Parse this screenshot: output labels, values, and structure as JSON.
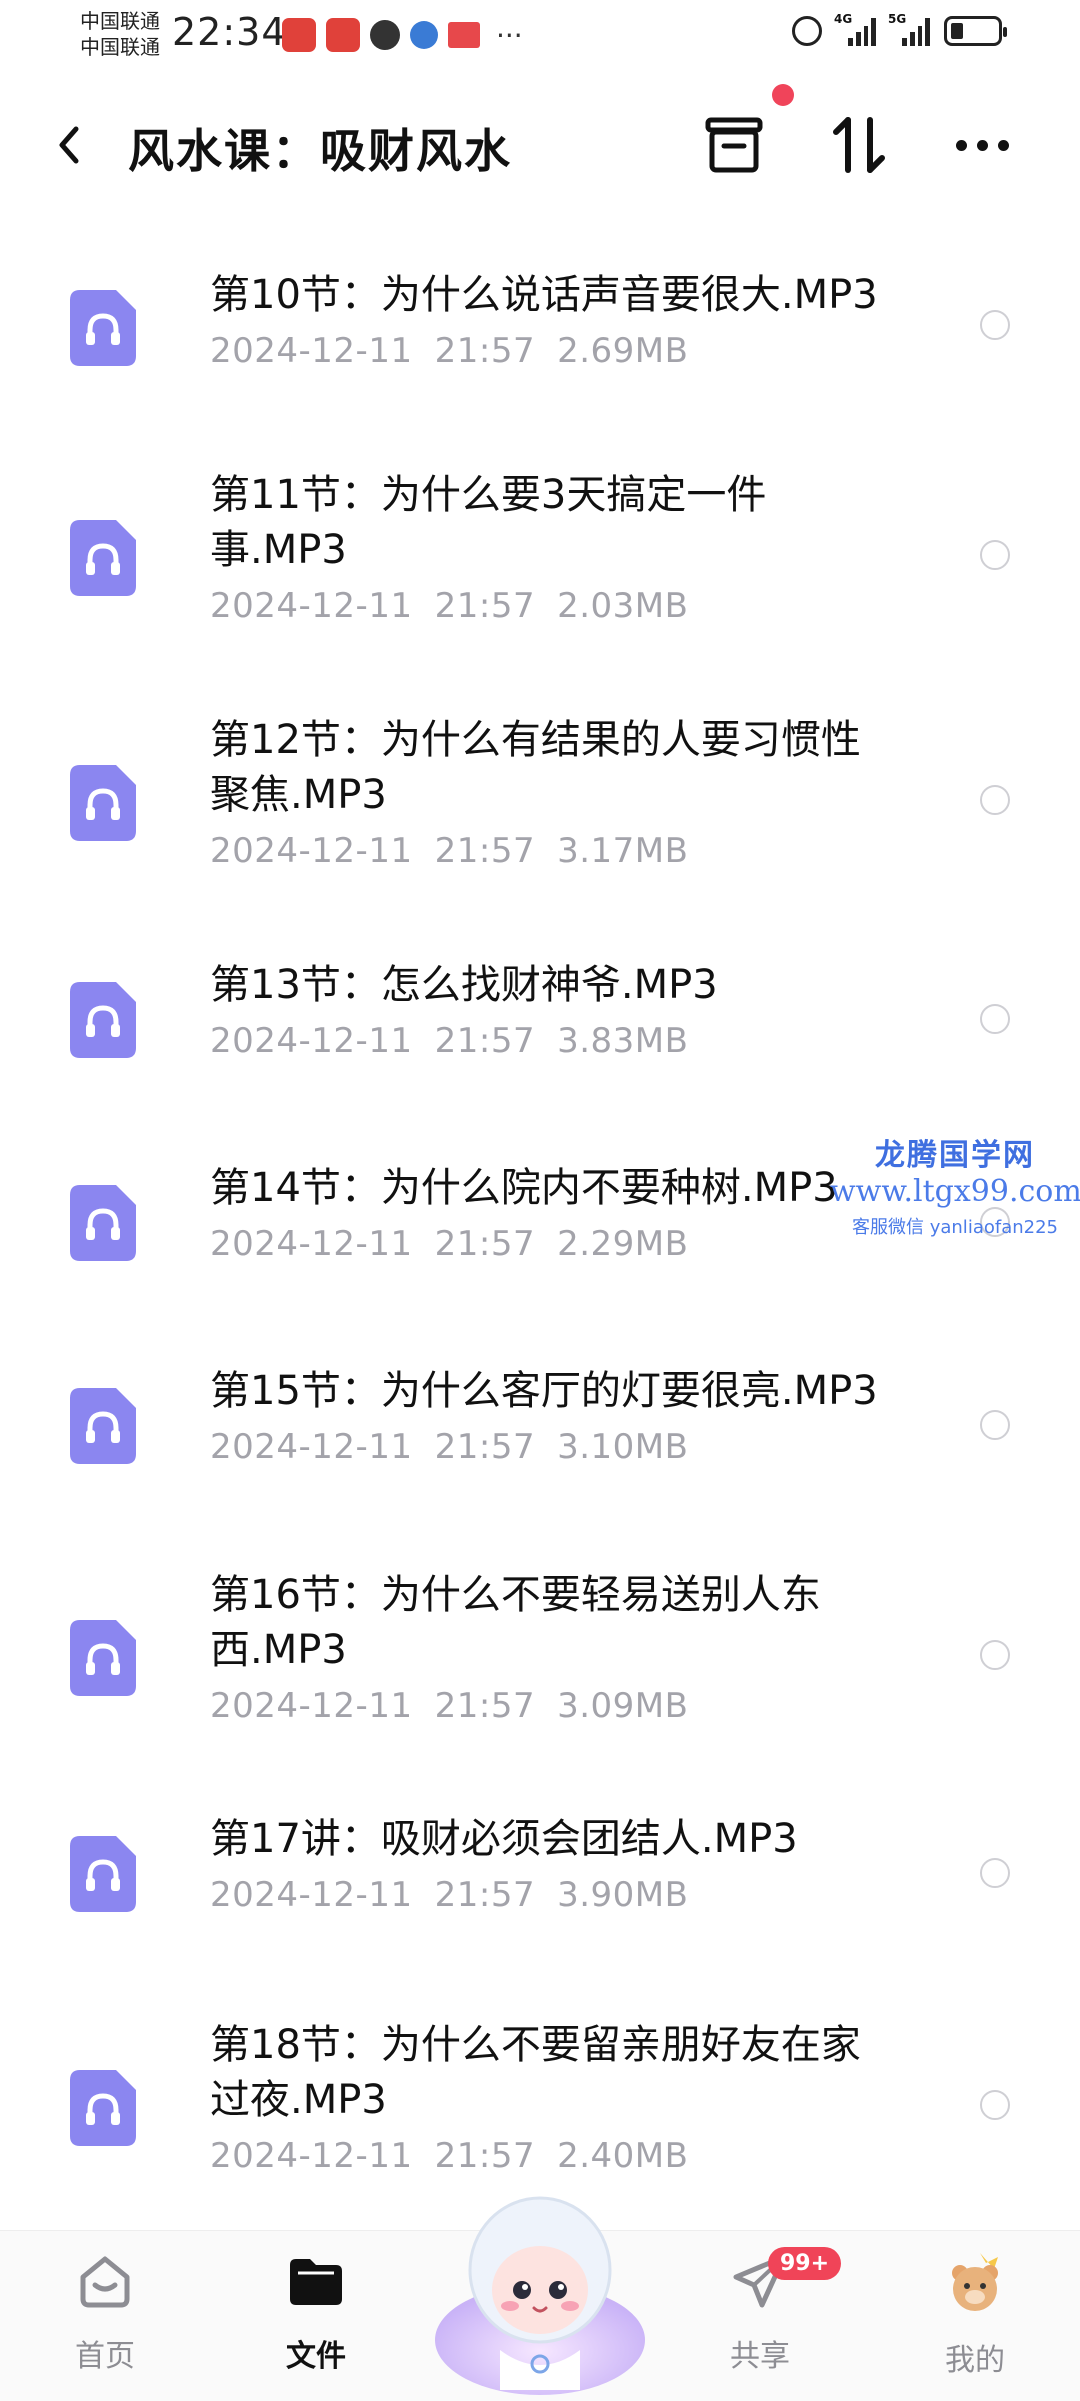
{
  "status_bar": {
    "carrier_1": "中国联通",
    "carrier_2": "中国联通",
    "time": "22:34",
    "more": "···",
    "network_1": "4G",
    "network_2": "5G"
  },
  "header": {
    "title": "风水课：吸财风水"
  },
  "files": [
    {
      "name": "第10节：为什么说话声音要很大.MP3",
      "date": "2024-12-11",
      "time": "21:57",
      "size": "2.69MB"
    },
    {
      "name": "第11节：为什么要3天搞定一件事.MP3",
      "date": "2024-12-11",
      "time": "21:57",
      "size": "2.03MB"
    },
    {
      "name": "第12节：为什么有结果的人要习惯性聚焦.MP3",
      "date": "2024-12-11",
      "time": "21:57",
      "size": "3.17MB"
    },
    {
      "name": "第13节：怎么找财神爷.MP3",
      "date": "2024-12-11",
      "time": "21:57",
      "size": "3.83MB"
    },
    {
      "name": "第14节：为什么院内不要种树.MP3",
      "date": "2024-12-11",
      "time": "21:57",
      "size": "2.29MB"
    },
    {
      "name": "第15节：为什么客厅的灯要很亮.MP3",
      "date": "2024-12-11",
      "time": "21:57",
      "size": "3.10MB"
    },
    {
      "name": "第16节：为什么不要轻易送别人东西.MP3",
      "date": "2024-12-11",
      "time": "21:57",
      "size": "3.09MB"
    },
    {
      "name": "第17讲：吸财必须会团结人.MP3",
      "date": "2024-12-11",
      "time": "21:57",
      "size": "3.90MB"
    },
    {
      "name": "第18节：为什么不要留亲朋好友在家过夜.MP3",
      "date": "2024-12-11",
      "time": "21:57",
      "size": "2.40MB"
    }
  ],
  "watermark": {
    "line1": "龙腾国学网",
    "line2": "www.ltgx99.com",
    "line3": "客服微信 yanliaofan225"
  },
  "nav": {
    "home": "首页",
    "files": "文件",
    "share": "共享",
    "share_badge": "99+",
    "mine": "我的"
  },
  "colors": {
    "file_icon": "#8b86f0",
    "badge": "#f04458",
    "meta_text": "#a3a3aa"
  }
}
